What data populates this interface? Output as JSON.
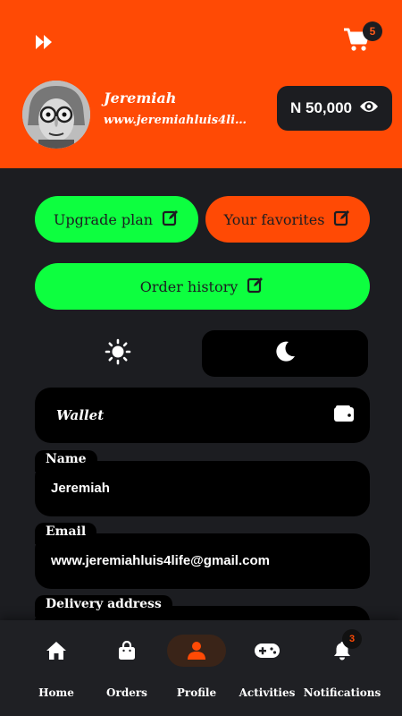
{
  "header": {
    "cart_count": "5",
    "accent_color": "#ff4a05"
  },
  "user": {
    "name": "Jeremiah",
    "website": "www.jeremiahluis4life..."
  },
  "balance": {
    "amount": "N 50,000"
  },
  "actions": {
    "upgrade_label": "Upgrade plan",
    "favorites_label": "Your favorites",
    "order_history_label": "Order history"
  },
  "theme": {
    "selected": "dark"
  },
  "wallet": {
    "label": "Wallet"
  },
  "fields": {
    "name_label": "Name",
    "name_value": "Jeremiah",
    "email_label": "Email",
    "email_value": "www.jeremiahluis4life@gmail.com",
    "address_label": "Delivery address"
  },
  "nav": {
    "home": "Home",
    "orders": "Orders",
    "profile": "Profile",
    "activities": "Activities",
    "notifications": "Notifications",
    "notifications_count": "3",
    "active": "profile"
  }
}
